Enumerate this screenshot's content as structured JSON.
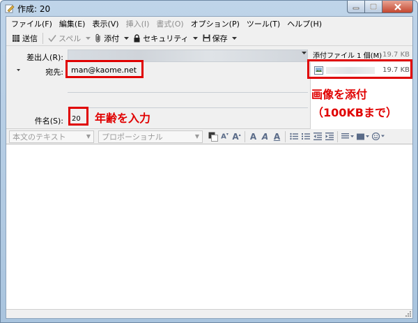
{
  "window": {
    "title": "作成: 20"
  },
  "menu": [
    "ファイル(F)",
    "編集(E)",
    "表示(V)",
    "挿入(I)",
    "書式(O)",
    "オプション(P)",
    "ツール(T)",
    "ヘルプ(H)"
  ],
  "toolbar": {
    "send": "送信",
    "spell": "スペル",
    "attach": "添付",
    "security": "セキュリティ",
    "save": "保存"
  },
  "header": {
    "from_label": "差出人(R):",
    "to_label": "宛先:",
    "to_value": "man@kaome.net",
    "subject_label": "件名(S):",
    "subject_value": "20",
    "attach_label": "添付ファイル 1 個(M)",
    "attach_total": "19.7 KB",
    "attach_item_size": "19.7 KB"
  },
  "annotations": {
    "age": "年齢を入力",
    "image_line1": "画像を添付",
    "image_line2": "（100KBまで）"
  },
  "format": {
    "paragraph": "本文のテキスト",
    "font": "プロポーショナル"
  },
  "colors": {
    "highlight": "#e00000"
  }
}
